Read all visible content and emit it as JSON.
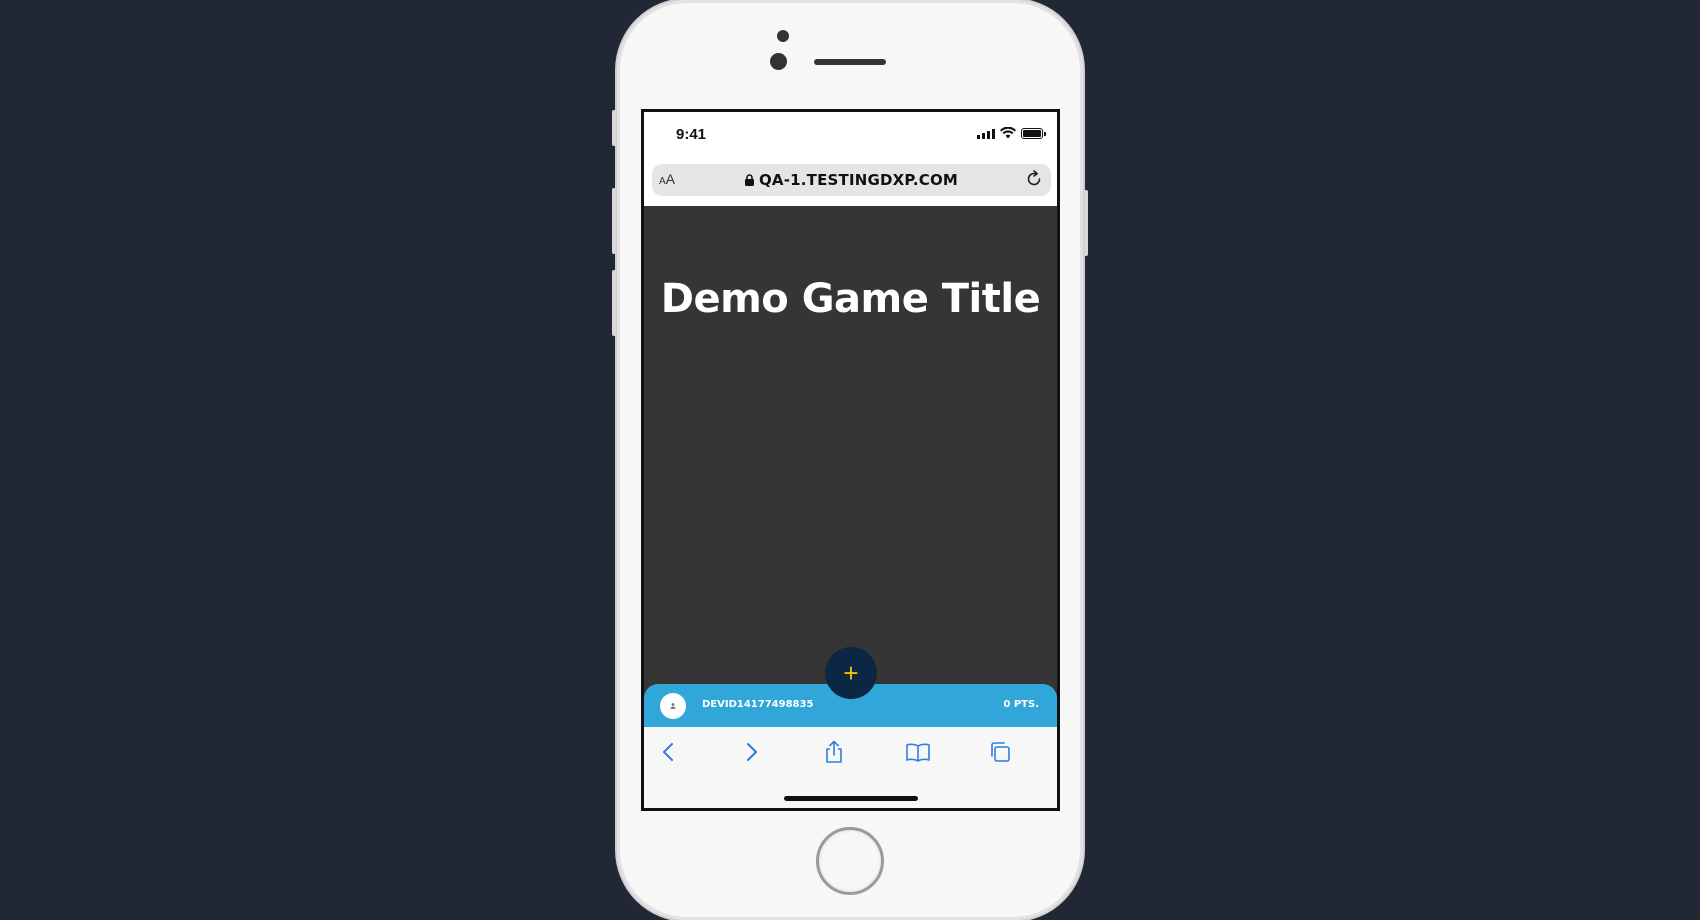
{
  "status_bar": {
    "time": "9:41"
  },
  "address_bar": {
    "text_size_label_small": "A",
    "text_size_label_large": "A",
    "url": "QA-1.TESTINGDXP.COM"
  },
  "page": {
    "title": "Demo Game Title",
    "background": "#353535"
  },
  "user_bar": {
    "username": "DEVID14177498835",
    "points": "0 PTS.",
    "color": "#31a7d9"
  },
  "fab": {
    "label": "+",
    "color": "#0b2744",
    "icon_color": "#f2c200"
  },
  "toolbar": {
    "items": [
      "back-icon",
      "forward-icon",
      "share-icon",
      "bookmarks-icon",
      "tabs-icon"
    ],
    "accent": "#2f7de1"
  }
}
